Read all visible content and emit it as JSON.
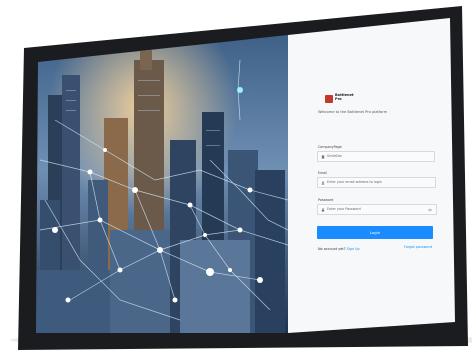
{
  "login": {
    "brand_line1": "Bottlenet",
    "brand_line2": "Pro",
    "welcome": "Welcome to the Bottlenet Pro platform",
    "company_label": "CompanyPage",
    "company_value": "SinVeDar",
    "email_label": "Email",
    "email_placeholder": "Enter your email address to login",
    "password_label": "Password",
    "password_placeholder": "Enter your Password",
    "login_button": "Login",
    "no_account_text": "No account yet?",
    "signup_link": "Sign Up",
    "forgot_link": "Forgot password"
  },
  "colors": {
    "accent": "#1a8cff",
    "brand_red": "#c0392b",
    "bezel": "#1b1c1f"
  }
}
